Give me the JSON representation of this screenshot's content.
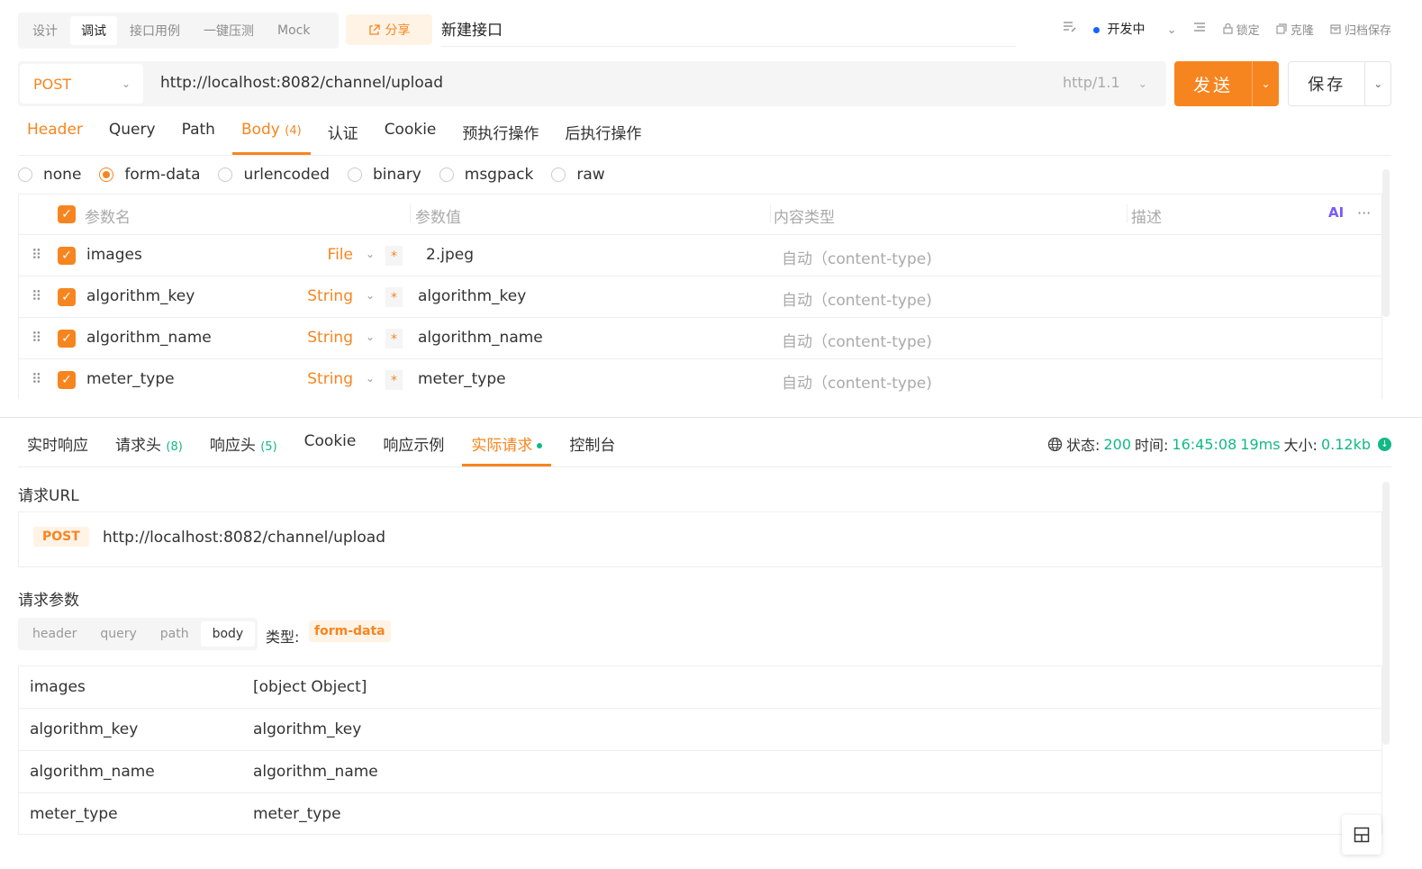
{
  "mode_tabs": [
    "设计",
    "调试",
    "接口用例",
    "一键压测",
    "Mock"
  ],
  "active_mode": "调试",
  "share_label": "分享",
  "api_name": "新建接口",
  "top_right": {
    "status": "开发中",
    "lock": "锁定",
    "clone": "克隆",
    "archive": "归档保存"
  },
  "request": {
    "method": "POST",
    "url": "http://localhost:8082/channel/upload",
    "http_version": "http/1.1",
    "send_label": "发送",
    "save_label": "保存"
  },
  "request_tabs": [
    {
      "label": "Header",
      "count": ""
    },
    {
      "label": "Query",
      "count": ""
    },
    {
      "label": "Path",
      "count": ""
    },
    {
      "label": "Body",
      "count": "(4)"
    },
    {
      "label": "认证",
      "count": ""
    },
    {
      "label": "Cookie",
      "count": ""
    },
    {
      "label": "预执行操作",
      "count": ""
    },
    {
      "label": "后执行操作",
      "count": ""
    }
  ],
  "body_types": [
    "none",
    "form-data",
    "urlencoded",
    "binary",
    "msgpack",
    "raw"
  ],
  "selected_body_type": "form-data",
  "params_header": {
    "name": "参数名",
    "value": "参数值",
    "content_type": "内容类型",
    "description": "描述",
    "ai": "AI"
  },
  "params": [
    {
      "name": "images",
      "type": "File",
      "required": "*",
      "value": "2.jpeg",
      "content_type": "自动（content-type)"
    },
    {
      "name": "algorithm_key",
      "type": "String",
      "required": "*",
      "value": "algorithm_key",
      "content_type": "自动（content-type)"
    },
    {
      "name": "algorithm_name",
      "type": "String",
      "required": "*",
      "value": "algorithm_name",
      "content_type": "自动（content-type)"
    },
    {
      "name": "meter_type",
      "type": "String",
      "required": "*",
      "value": "meter_type",
      "content_type": "自动（content-type)"
    }
  ],
  "response_tabs": [
    {
      "label": "实时响应",
      "count": ""
    },
    {
      "label": "请求头",
      "count": "(8)"
    },
    {
      "label": "响应头",
      "count": "(5)"
    },
    {
      "label": "Cookie",
      "count": ""
    },
    {
      "label": "响应示例",
      "count": ""
    },
    {
      "label": "实际请求",
      "count": ""
    },
    {
      "label": "控制台",
      "count": ""
    }
  ],
  "response_status": {
    "status_label": "状态:",
    "status": "200",
    "time_label": "时间:",
    "time": "16:45:08",
    "duration": "19ms",
    "size_label": "大小:",
    "size": "0.12kb"
  },
  "actual_request": {
    "url_title": "请求URL",
    "method": "POST",
    "url": "http://localhost:8082/channel/upload",
    "params_title": "请求参数",
    "segments": [
      "header",
      "query",
      "path",
      "body"
    ],
    "active_segment": "body",
    "type_label": "类型:",
    "type_value": "form-data",
    "rows": [
      {
        "key": "images",
        "value": "[object Object]"
      },
      {
        "key": "algorithm_key",
        "value": "algorithm_key"
      },
      {
        "key": "algorithm_name",
        "value": "algorithm_name"
      },
      {
        "key": "meter_type",
        "value": "meter_type"
      }
    ]
  },
  "colors": {
    "accent": "#f7851f",
    "success": "#12b886",
    "dev_status": "#1664ff"
  }
}
